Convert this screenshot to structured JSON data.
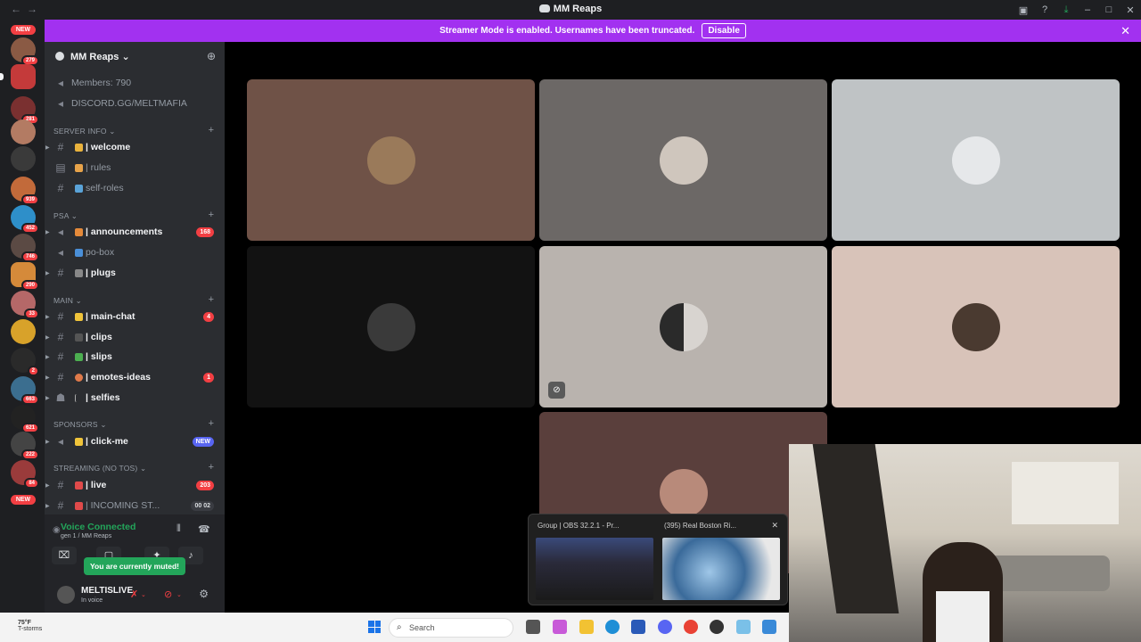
{
  "window": {
    "title": "MM Reaps"
  },
  "banner": {
    "text": "Streamer Mode is enabled. Usernames have been truncated.",
    "button": "Disable"
  },
  "rail": {
    "new_label": "NEW",
    "badges": [
      "279",
      "281",
      "939",
      "452",
      "746",
      "290",
      "33",
      "2",
      "663",
      "621",
      "222",
      "84"
    ]
  },
  "server": {
    "name": "MM Reaps",
    "members": "Members: 790",
    "invite": "DISCORD.GG/MELTMAFIA"
  },
  "categories": {
    "server_info": "SERVER INFO",
    "psa": "PSA",
    "main": "MAIN",
    "sponsors": "SPONSORS",
    "streaming": "STREAMING (NO TOS)"
  },
  "channels": [
    {
      "name": "| welcome",
      "bold": true
    },
    {
      "name": "| rules",
      "bold": false
    },
    {
      "name": "self-roles",
      "bold": false
    },
    {
      "name": "| announcements",
      "bold": true,
      "count": "168"
    },
    {
      "name": "po-box",
      "bold": false
    },
    {
      "name": "| plugs",
      "bold": true
    },
    {
      "name": "| main-chat",
      "bold": true,
      "count": "4"
    },
    {
      "name": "| clips",
      "bold": true
    },
    {
      "name": "| slips",
      "bold": true
    },
    {
      "name": "| emotes-ideas",
      "bold": true,
      "count": "1"
    },
    {
      "name": "| selfies",
      "bold": true
    },
    {
      "name": "| click-me",
      "bold": true,
      "count": "NEW"
    },
    {
      "name": "| live",
      "bold": true,
      "count": "203"
    },
    {
      "name": "| INCOMING ST...",
      "bold": false,
      "count": "00 02"
    }
  ],
  "voice": {
    "status": "Voice Connected",
    "channel": "gen 1 / MM Reaps",
    "tooltip": "You are currently muted!"
  },
  "user": {
    "name": "MELTISLIVE",
    "status": "In voice"
  },
  "thumbnails": [
    {
      "caption": "Group | OBS 32.2.1 - Pr..."
    },
    {
      "caption": "(395) Real Boston Ri..."
    }
  ],
  "taskbar": {
    "temp": "75°F",
    "weather": "T-storms",
    "search_placeholder": "Search"
  },
  "colors": {
    "banner": "#a231f0",
    "sidebar": "#2b2d31",
    "rail": "#1e1f22",
    "unread_badge": "#f23f43",
    "voice_green": "#23a55a",
    "tiles": [
      "#6f5247",
      "#6c6866",
      "#bfc3c5",
      "#121212",
      "#b9b3ae",
      "#d8c3b9",
      "#5a3f3c"
    ]
  }
}
